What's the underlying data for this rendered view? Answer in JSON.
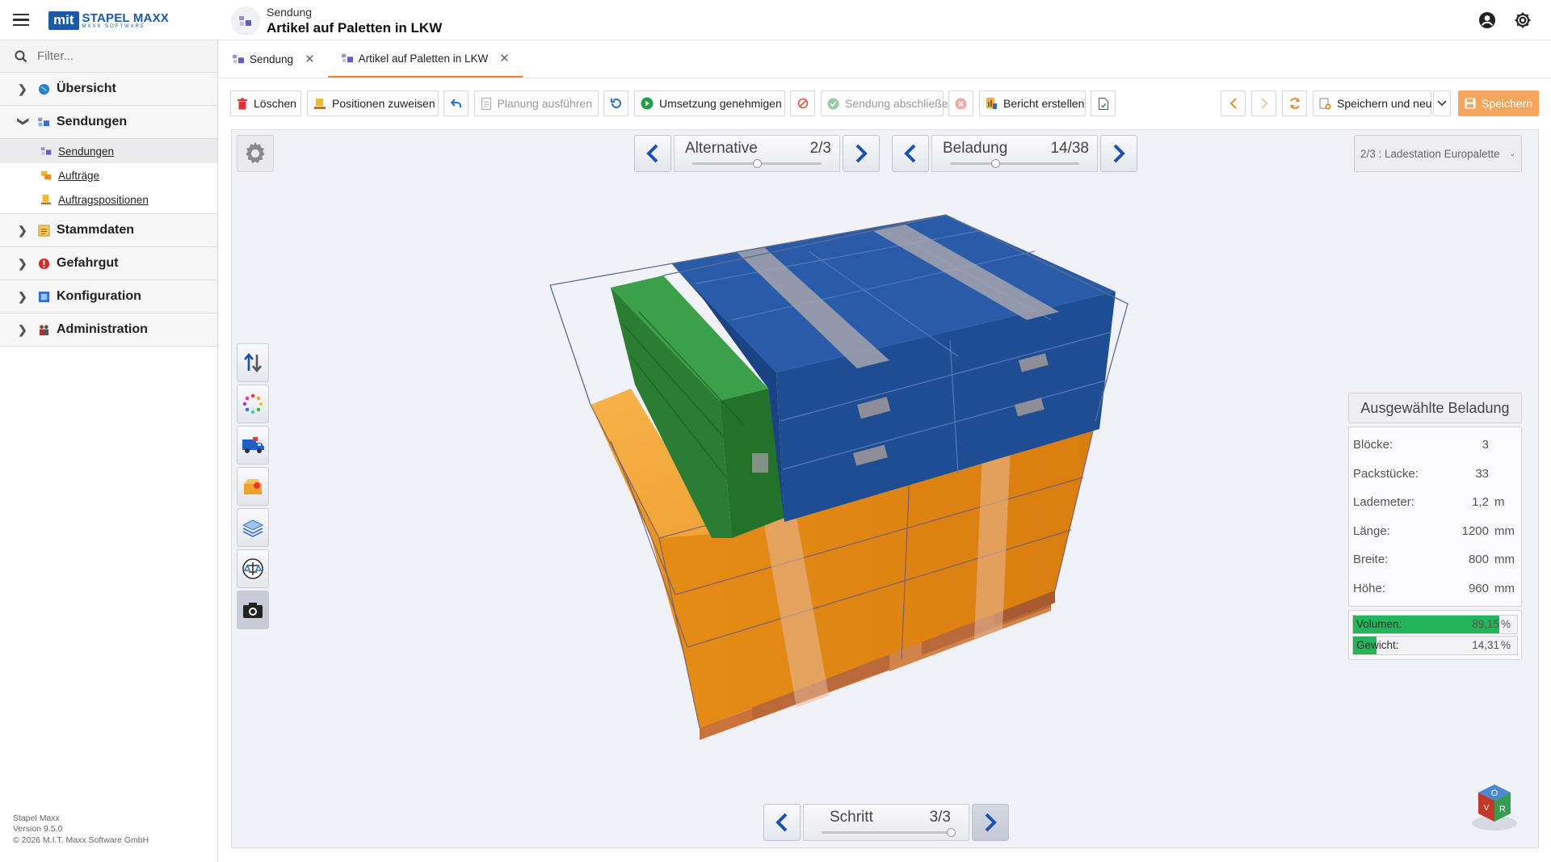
{
  "brand": {
    "logo_mark": "mit",
    "name": "STAPEL MAXX",
    "tagline": "MAXX SOFTWARE",
    "accent": "#1d5aa6"
  },
  "header": {
    "breadcrumb": "Sendung",
    "title": "Artikel auf Paletten in LKW",
    "account_icon": "account-circle-icon",
    "settings_icon": "gear-icon"
  },
  "sidebar": {
    "filter_placeholder": "Filter...",
    "items": [
      {
        "label": "Übersicht",
        "icon": "globe-icon",
        "expanded": false
      },
      {
        "label": "Sendungen",
        "icon": "shipments-icon",
        "expanded": true
      },
      {
        "label": "Stammdaten",
        "icon": "master-data-icon",
        "expanded": false
      },
      {
        "label": "Gefahrgut",
        "icon": "hazard-icon",
        "expanded": false
      },
      {
        "label": "Konfiguration",
        "icon": "config-icon",
        "expanded": false
      },
      {
        "label": "Administration",
        "icon": "admin-icon",
        "expanded": false
      }
    ],
    "subitems": [
      {
        "label": "Sendungen",
        "active": true
      },
      {
        "label": "Aufträge",
        "active": false
      },
      {
        "label": "Auftragspositionen",
        "active": false
      }
    ],
    "footer": {
      "product": "Stapel Maxx",
      "version": "Version 9.5.0",
      "copyright": "© 2026 M.I.T. Maxx Software GmbH"
    }
  },
  "tabs": [
    {
      "label": "Sendung",
      "active": false
    },
    {
      "label": "Artikel auf Paletten in LKW",
      "active": true
    }
  ],
  "toolbar": {
    "delete": "Löschen",
    "assign": "Positionen zuweisen",
    "plan": "Planung ausführen",
    "approve": "Umsetzung genehmigen",
    "close": "Sendung abschließen",
    "report": "Bericht erstellen",
    "save_new": "Speichern und neu",
    "save": "Speichern"
  },
  "viewer": {
    "alternative": {
      "label": "Alternative",
      "value": "2/3",
      "position": 0.5
    },
    "loading": {
      "label": "Beladung",
      "value": "14/38",
      "position": 0.35
    },
    "step": {
      "label": "Schritt",
      "value": "3/3",
      "position": 1.0
    },
    "alternative_select": "2/3 : Ladestation Europalette",
    "side_tools": [
      "swap-arrows-icon",
      "color-dots-icon",
      "truck-icon",
      "open-box-icon",
      "layers-icon",
      "scale-icon",
      "camera-icon"
    ],
    "orientation_cube": {
      "faces": [
        "O",
        "R",
        "V"
      ]
    }
  },
  "info": {
    "title": "Ausgewählte Beladung",
    "rows": [
      {
        "label": "Blöcke:",
        "value": "3",
        "unit": ""
      },
      {
        "label": "Packstücke:",
        "value": "33",
        "unit": ""
      },
      {
        "label": "Lademeter:",
        "value": "1,2",
        "unit": "m"
      },
      {
        "label": "Länge:",
        "value": "1200",
        "unit": "mm"
      },
      {
        "label": "Breite:",
        "value": "800",
        "unit": "mm"
      },
      {
        "label": "Höhe:",
        "value": "960",
        "unit": "mm"
      }
    ],
    "bars": [
      {
        "label": "Volumen:",
        "value": "89,15",
        "unit": "%",
        "fraction": 0.8915
      },
      {
        "label": "Gewicht:",
        "value": "14,31",
        "unit": "%",
        "fraction": 0.1431
      }
    ]
  },
  "colors": {
    "orange_box": "#f0961f",
    "blue_box": "#1e4c94",
    "green_box": "#2d8a35",
    "pallet": "#d98a45",
    "save_button": "#f5a65e",
    "tab_underline": "#e8803a"
  }
}
